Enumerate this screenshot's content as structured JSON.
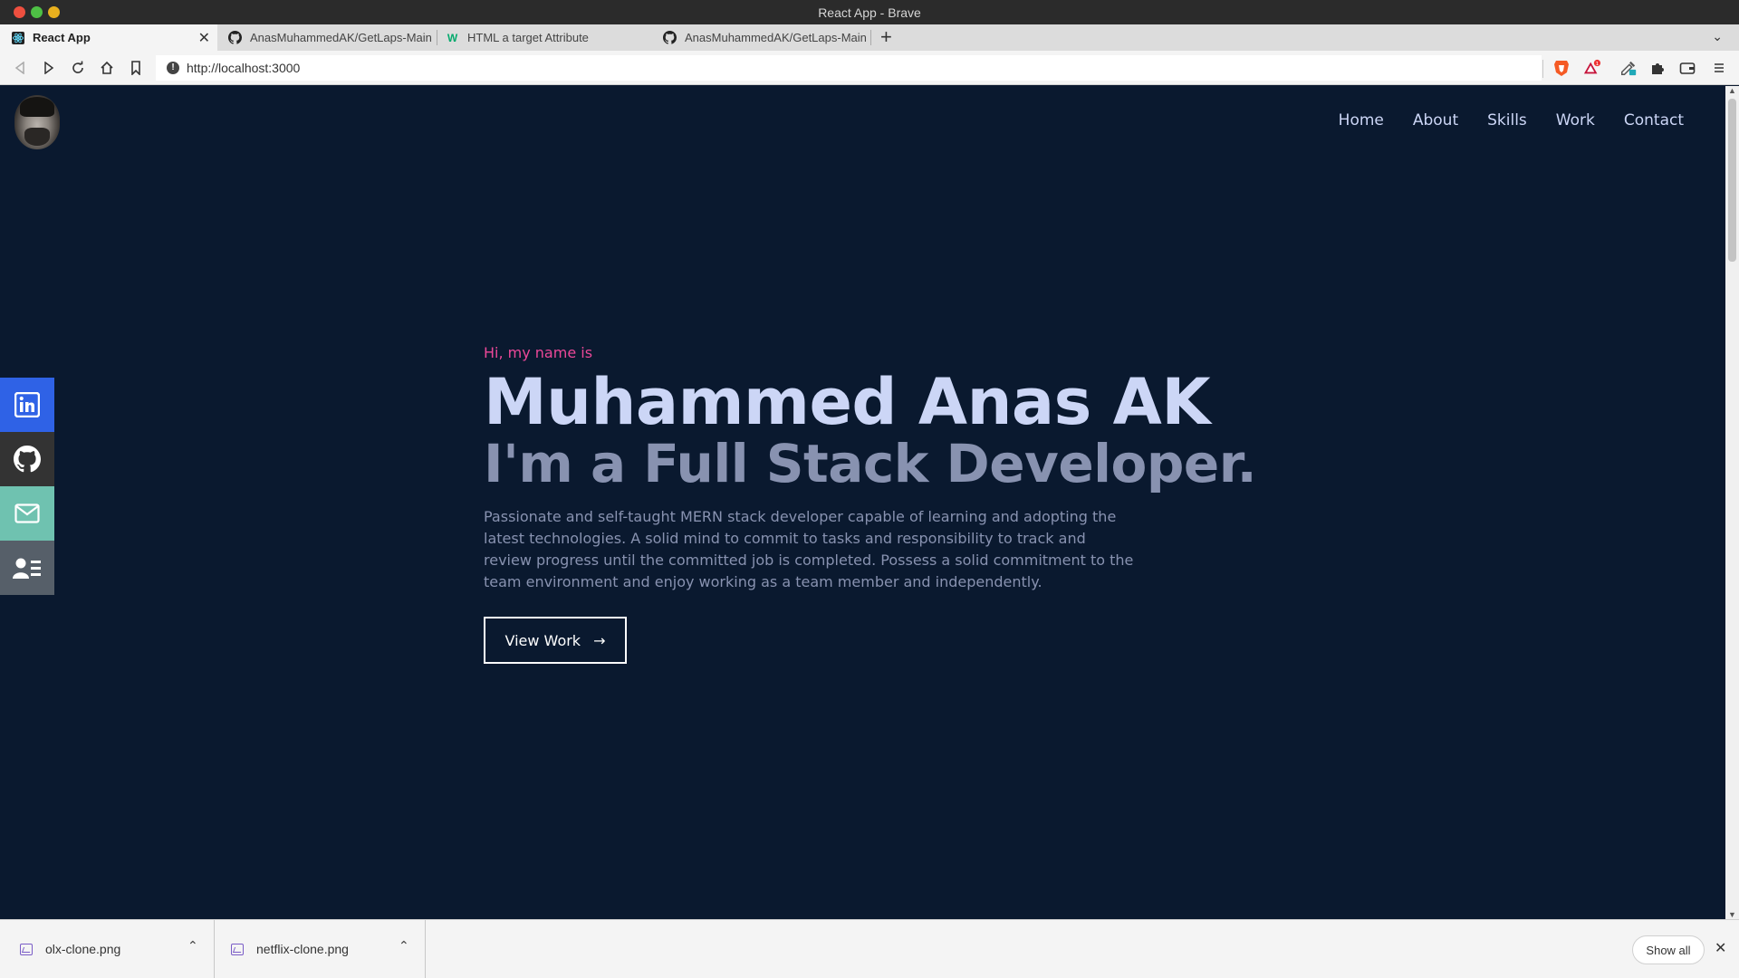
{
  "window": {
    "title": "React App - Brave"
  },
  "tabs": [
    {
      "label": "React App",
      "favicon": "react-icon",
      "active": true
    },
    {
      "label": "AnasMuhammedAK/GetLaps-Main",
      "favicon": "github-icon",
      "active": false
    },
    {
      "label": "HTML a target Attribute",
      "favicon": "w3schools-icon",
      "active": false
    },
    {
      "label": "AnasMuhammedAK/GetLaps-Main",
      "favicon": "github-icon",
      "active": false
    }
  ],
  "toolbar": {
    "url": "http://localhost:3000"
  },
  "nav": {
    "items": [
      "Home",
      "About",
      "Skills",
      "Work",
      "Contact"
    ]
  },
  "social": [
    {
      "icon": "linkedin-icon",
      "color": "#2f62e6"
    },
    {
      "icon": "github-icon",
      "color": "#333333"
    },
    {
      "icon": "mail-icon",
      "color": "#6fc2b0"
    },
    {
      "icon": "resume-icon",
      "color": "#565f69"
    }
  ],
  "hero": {
    "greeting": "Hi, my name is",
    "name": "Muhammed Anas AK",
    "role": "I'm a Full Stack Developer.",
    "description": "Passionate and self-taught MERN stack developer capable of learning and adopting the latest technologies. A solid mind to commit to tasks and responsibility to track and review progress until the committed job is completed. Possess a solid commitment to the team environment and enjoy working as a team member and independently.",
    "cta_label": "View Work",
    "cta_arrow": "→"
  },
  "colors": {
    "background": "#0a192f",
    "accent": "#ec4899",
    "heading": "#ccd6f6",
    "muted": "#8892b0"
  },
  "downloads": {
    "items": [
      "olx-clone.png",
      "netflix-clone.png"
    ],
    "show_all_label": "Show all"
  }
}
